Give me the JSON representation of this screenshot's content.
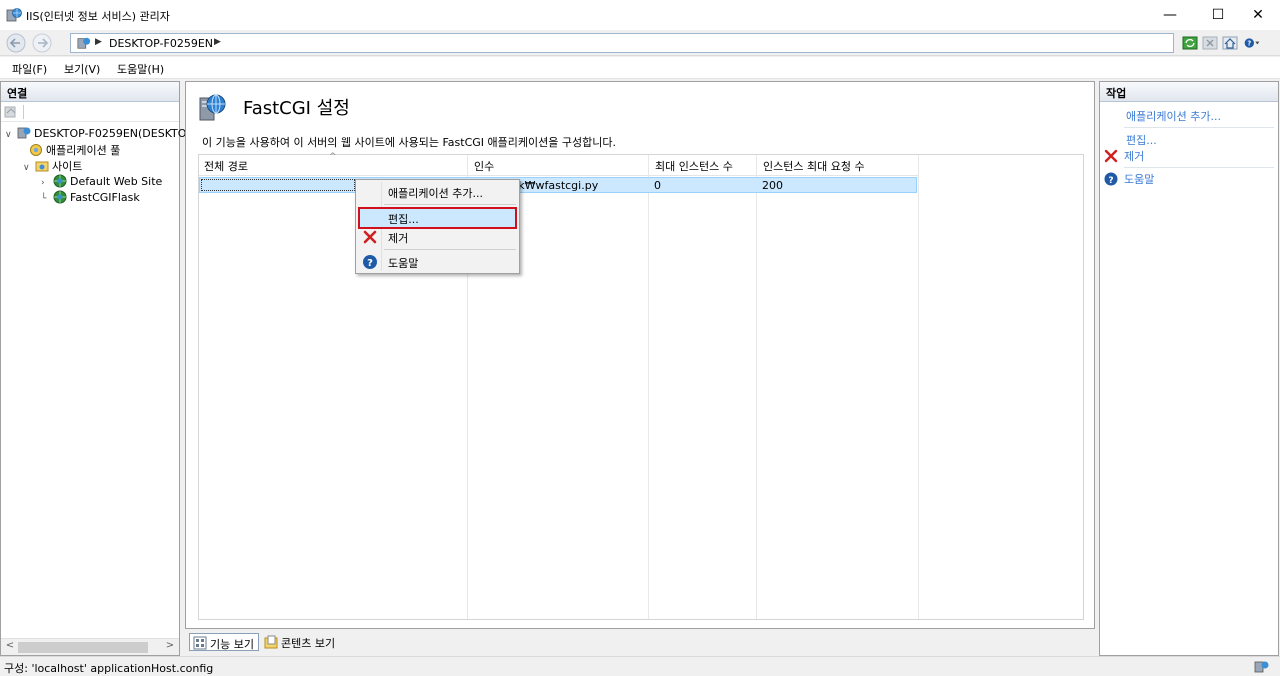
{
  "window": {
    "title": "IIS(인터넷 정보 서비스) 관리자",
    "minimize": "—",
    "maximize": "☐",
    "close": "✕"
  },
  "address": {
    "crumb": "DESKTOP-F0259EN",
    "arrow": "▶"
  },
  "menu": {
    "file": "파일(F)",
    "view": "보기(V)",
    "help": "도움말(H)"
  },
  "connections": {
    "header": "연결",
    "tree": [
      {
        "label": "DESKTOP-F0259EN(DESKTOP",
        "icon": "server-icon"
      },
      {
        "label": "애플리케이션 풀",
        "icon": "app-pool-icon"
      },
      {
        "label": "사이트",
        "icon": "sites-folder-icon"
      },
      {
        "label": "Default Web Site",
        "icon": "globe-icon"
      },
      {
        "label": "FastCGIFlask",
        "icon": "globe-icon"
      }
    ]
  },
  "feature": {
    "title": "FastCGI 설정",
    "description": "이 기능을 사용하여 이 서버의 웹 사이트에 사용되는 FastCGI 애플리케이션을 구성합니다.",
    "columns": [
      "전체 경로",
      "인수",
      "최대 인스턴스 수",
      "인스턴스 최대 요청 수"
    ],
    "rows": [
      {
        "path": "",
        "arguments": "ub₩flask₩wfastcgi.py",
        "max_instances": "0",
        "max_requests": "200"
      }
    ]
  },
  "context_menu": {
    "items": [
      {
        "label": "애플리케이션 추가...",
        "icon": ""
      },
      {
        "label": "편집...",
        "icon": ""
      },
      {
        "label": "제거",
        "icon": "remove-icon"
      },
      {
        "label": "도움말",
        "icon": "help-icon"
      }
    ],
    "highlighted": "편집..."
  },
  "actions": {
    "header": "작업",
    "items": [
      {
        "label": "애플리케이션 추가..."
      },
      {
        "label": "편집..."
      },
      {
        "label": "제거"
      },
      {
        "label": "도움말"
      }
    ]
  },
  "view_tabs": {
    "features": "기능 보기",
    "content": "콘텐츠 보기"
  },
  "status": {
    "text": "구성: 'localhost' applicationHost.config"
  },
  "colors": {
    "accent_link": "#3a7bd5",
    "selection": "#cce8ff",
    "highlight_border": "#d0101a",
    "remove_red": "#d02020",
    "help_blue": "#1e5aa8"
  }
}
